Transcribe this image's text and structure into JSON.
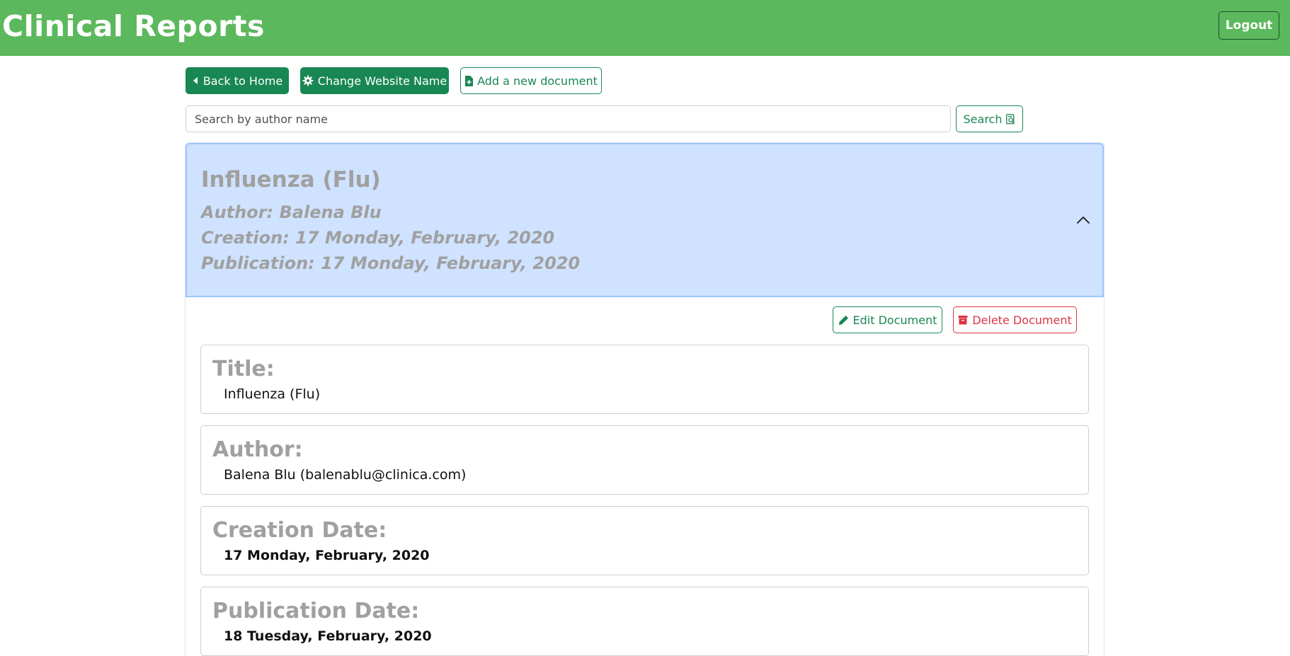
{
  "navbar": {
    "brand": "Clinical Reports",
    "logout_label": "Logout"
  },
  "toolbar": {
    "back_label": "Back to Home",
    "back_icon": "caret-left-icon",
    "change_name_label": "Change Website Name",
    "change_name_icon": "gear-icon",
    "add_document_label": "Add a new document",
    "add_document_icon": "file-plus-icon"
  },
  "search": {
    "placeholder": "Search by author name",
    "value": "",
    "button_label": "Search",
    "button_icon": "search-document-icon"
  },
  "document": {
    "header": {
      "title": "Influenza (Flu)",
      "author_line": "Author: Balena Blu",
      "creation_line": "Creation: 17 Monday, February, 2020",
      "publication_line": "Publication: 17 Monday, February, 2020",
      "expanded": true,
      "toggle_icon": "chevron-up-icon"
    },
    "actions": {
      "edit_label": "Edit Document",
      "edit_icon": "pencil-icon",
      "delete_label": "Delete Document",
      "delete_icon": "archive-icon"
    },
    "fields": [
      {
        "label": "Title:",
        "value": "Influenza (Flu)"
      },
      {
        "label": "Author:",
        "value": "Balena Blu (balenablu@clinica.com)"
      },
      {
        "label": "Creation Date:",
        "value": "17 Monday, February, 2020"
      },
      {
        "label": "Publication Date:",
        "value": "18 Tuesday, February, 2020"
      }
    ]
  },
  "colors": {
    "navbar": "#5cb85c",
    "primary_green": "#198754",
    "danger": "#dc3545",
    "accordion_header": "#cfe2ff",
    "muted_text": "#a0a0a0"
  }
}
